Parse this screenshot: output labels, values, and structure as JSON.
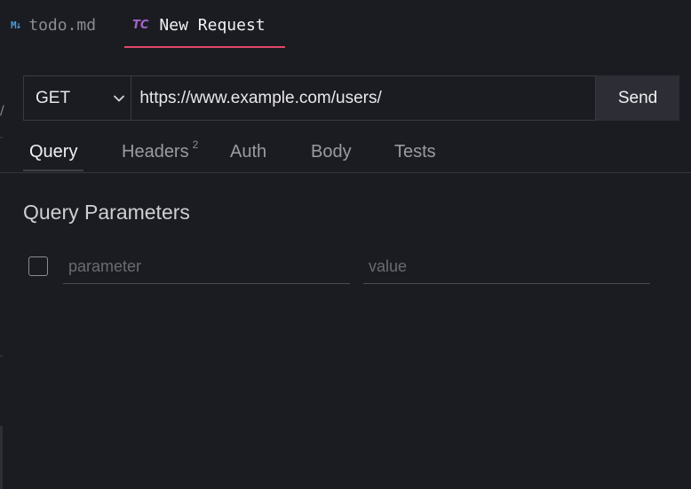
{
  "tabs": [
    {
      "icon": "markdown-icon",
      "icon_text": "M↓",
      "label": "todo.md",
      "active": false
    },
    {
      "icon": "tc-icon",
      "icon_text": "TC",
      "label": "New Request",
      "active": true
    }
  ],
  "request": {
    "method": "GET",
    "url": "https://www.example.com/users/",
    "send_label": "Send"
  },
  "subtabs": [
    {
      "label": "Query",
      "active": true
    },
    {
      "label": "Headers",
      "badge": "2"
    },
    {
      "label": "Auth"
    },
    {
      "label": "Body"
    },
    {
      "label": "Tests"
    }
  ],
  "query": {
    "title": "Query Parameters",
    "param_placeholder": "parameter",
    "value_placeholder": "value"
  },
  "colors": {
    "background": "#1b1c22",
    "accent": "#e0486c",
    "markdown_icon": "#4a9bd6",
    "tc_icon": "#a264c8"
  }
}
